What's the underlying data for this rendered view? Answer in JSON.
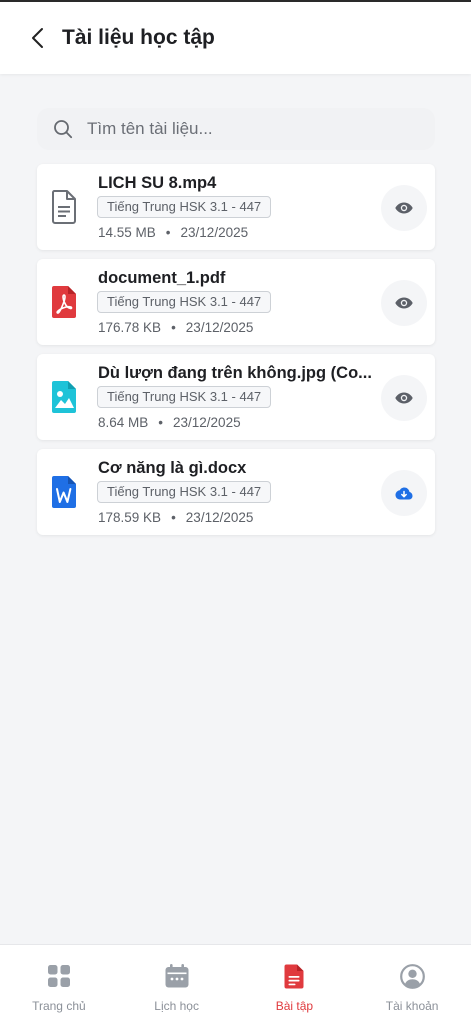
{
  "header": {
    "title": "Tài liệu học tập"
  },
  "search": {
    "placeholder": "Tìm tên tài liệu..."
  },
  "files": [
    {
      "name": "LICH SU 8.mp4",
      "tag": "Tiếng Trung HSK 3.1 - 447",
      "size": "14.55 MB",
      "dot": "•",
      "date": "23/12/2025",
      "icon": "generic-document-icon",
      "action": "view-eye-icon"
    },
    {
      "name": "document_1.pdf",
      "tag": "Tiếng Trung HSK 3.1 - 447",
      "size": "176.78 KB",
      "dot": "•",
      "date": "23/12/2025",
      "icon": "pdf-file-icon",
      "action": "view-eye-icon"
    },
    {
      "name": "Dù lượn đang trên không.jpg (Co...",
      "tag": "Tiếng Trung HSK 3.1 - 447",
      "size": "8.64 MB",
      "dot": "•",
      "date": "23/12/2025",
      "icon": "image-file-icon",
      "action": "view-eye-icon"
    },
    {
      "name": "Cơ năng là gì.docx",
      "tag": "Tiếng Trung HSK 3.1 - 447",
      "size": "178.59 KB",
      "dot": "•",
      "date": "23/12/2025",
      "icon": "word-file-icon",
      "action": "download-icon"
    }
  ],
  "nav": [
    {
      "label": "Trang chủ",
      "icon": "grid-home-icon",
      "active": false
    },
    {
      "label": "Lịch học",
      "icon": "calendar-icon",
      "active": false
    },
    {
      "label": "Bài tập",
      "icon": "assignment-document-icon",
      "active": true
    },
    {
      "label": "Tài khoản",
      "icon": "account-user-icon",
      "active": false
    }
  ],
  "colors": {
    "accent_active": "#e03a3e",
    "pdf_red": "#e03a3e",
    "image_cyan": "#1ec3d8",
    "word_blue": "#1f6fe5",
    "download_blue": "#1f6fe5",
    "inactive_gray": "#9aa0a8"
  }
}
